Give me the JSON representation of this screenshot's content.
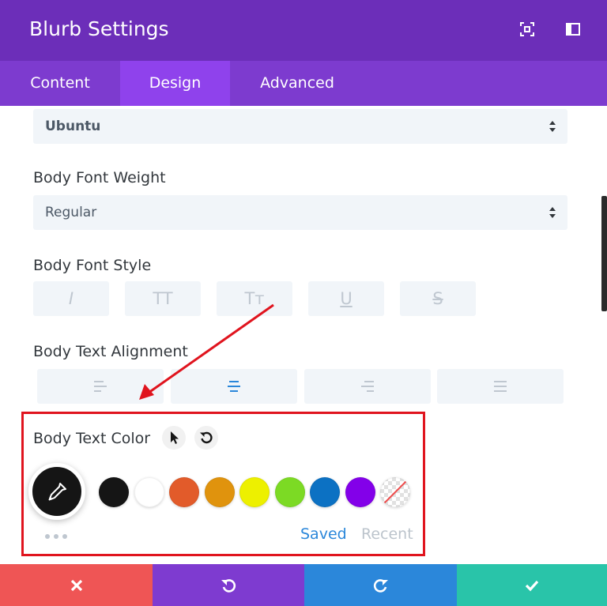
{
  "header": {
    "title": "Blurb Settings"
  },
  "tabs": [
    {
      "label": "Content",
      "active": false
    },
    {
      "label": "Design",
      "active": true
    },
    {
      "label": "Advanced",
      "active": false
    }
  ],
  "fields": {
    "font_family_value": "Ubuntu",
    "weight_label": "Body Font Weight",
    "weight_value": "Regular",
    "style_label": "Body Font Style",
    "style_buttons": [
      "I",
      "TT",
      "Tт",
      "U",
      "S"
    ],
    "alignment_label": "Body Text Alignment",
    "alignment_options": [
      "left",
      "center",
      "right",
      "justify"
    ],
    "color_label": "Body Text Color"
  },
  "swatches": [
    "#151515",
    "#ffffff",
    "#e25b2a",
    "#e0930d",
    "#edf000",
    "#7cda24",
    "#0c71c3",
    "#8300e9",
    "none"
  ],
  "palette_tabs": {
    "saved": "Saved",
    "recent": "Recent"
  },
  "footer_icons": [
    "close-icon",
    "undo-icon",
    "redo-icon",
    "check-icon"
  ],
  "colors": {
    "header": "#6c2eb9",
    "tabs": "#7d3bcf",
    "tab_active": "#8f42ec",
    "footer_close": "#ef5555",
    "footer_undo": "#7e3bd0",
    "footer_redo": "#2b87da",
    "footer_save": "#29c4a9",
    "highlight": "#e0141e"
  }
}
